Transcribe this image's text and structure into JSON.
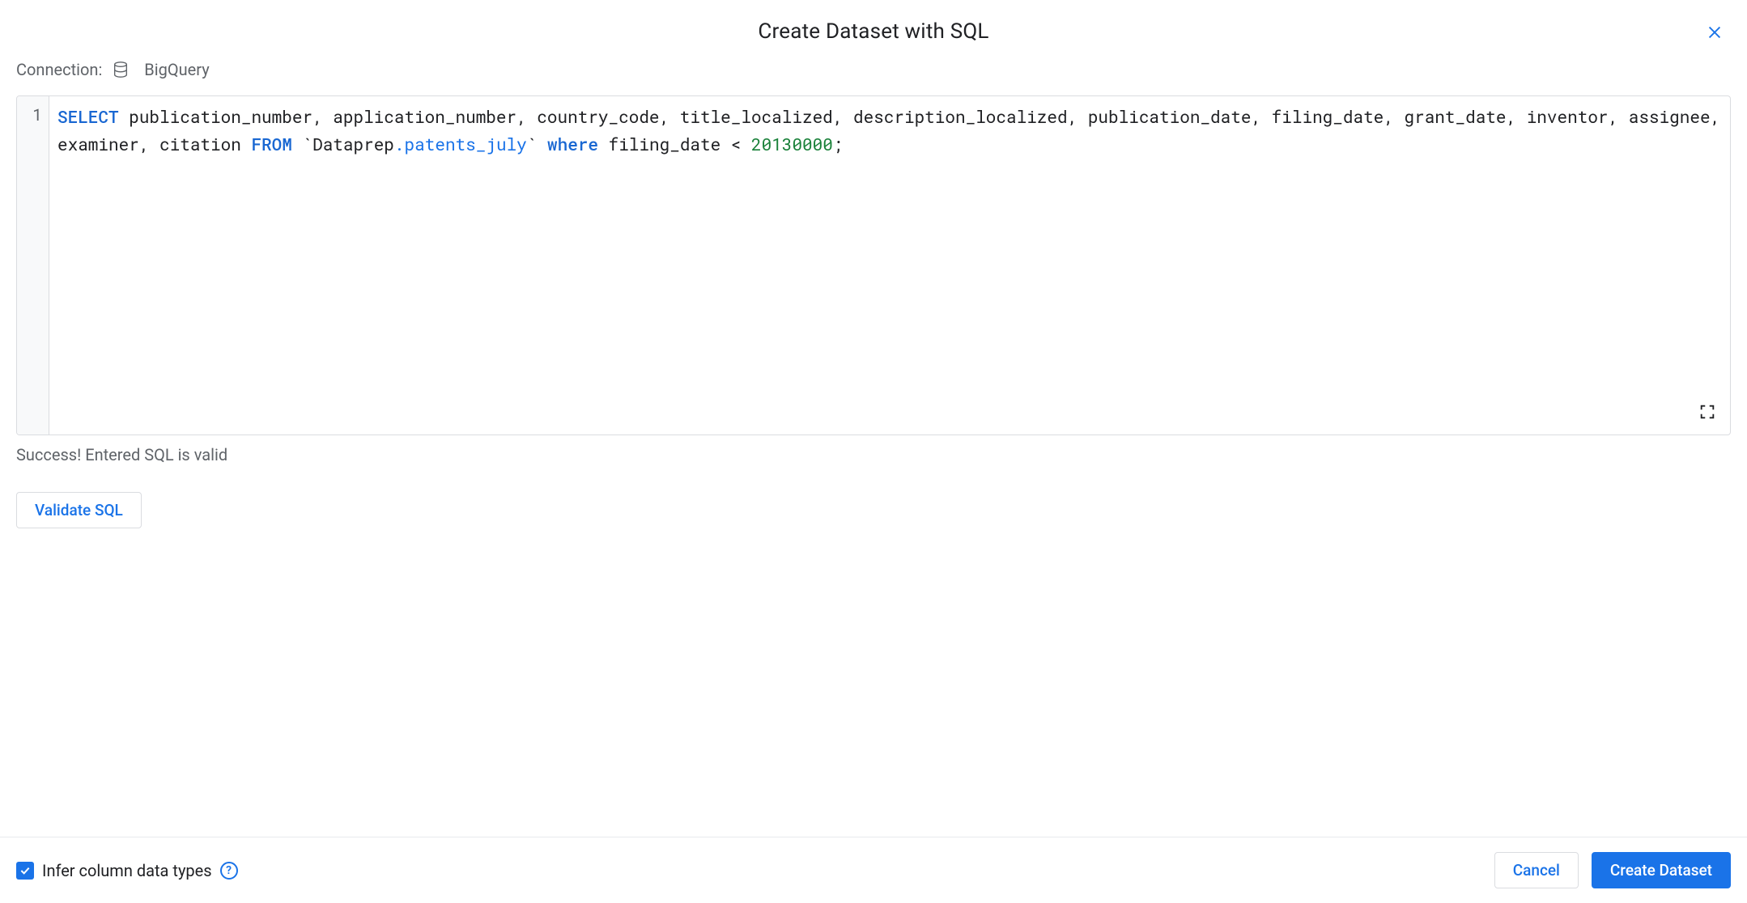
{
  "dialog": {
    "title": "Create Dataset with SQL"
  },
  "connection": {
    "label": "Connection:",
    "name": "BigQuery"
  },
  "editor": {
    "line_number": "1",
    "sql": {
      "select_kw": "SELECT",
      "columns": " publication_number, application_number, country_code, title_localized, description_localized, publication_date, filing_date, grant_date, inventor, assignee, examiner, citation ",
      "from_kw": "FROM",
      "backtick1": " `",
      "schema": "Dataprep",
      "dot": ".",
      "table": "patents_july",
      "backtick2": "` ",
      "where_kw": "where",
      "condition": " filing_date < ",
      "number": "20130000",
      "terminator": ";"
    }
  },
  "status": {
    "message": "Success! Entered SQL is valid"
  },
  "buttons": {
    "validate": "Validate SQL",
    "cancel": "Cancel",
    "create": "Create Dataset"
  },
  "footer": {
    "checkbox_label": "Infer column data types",
    "help_glyph": "?"
  }
}
